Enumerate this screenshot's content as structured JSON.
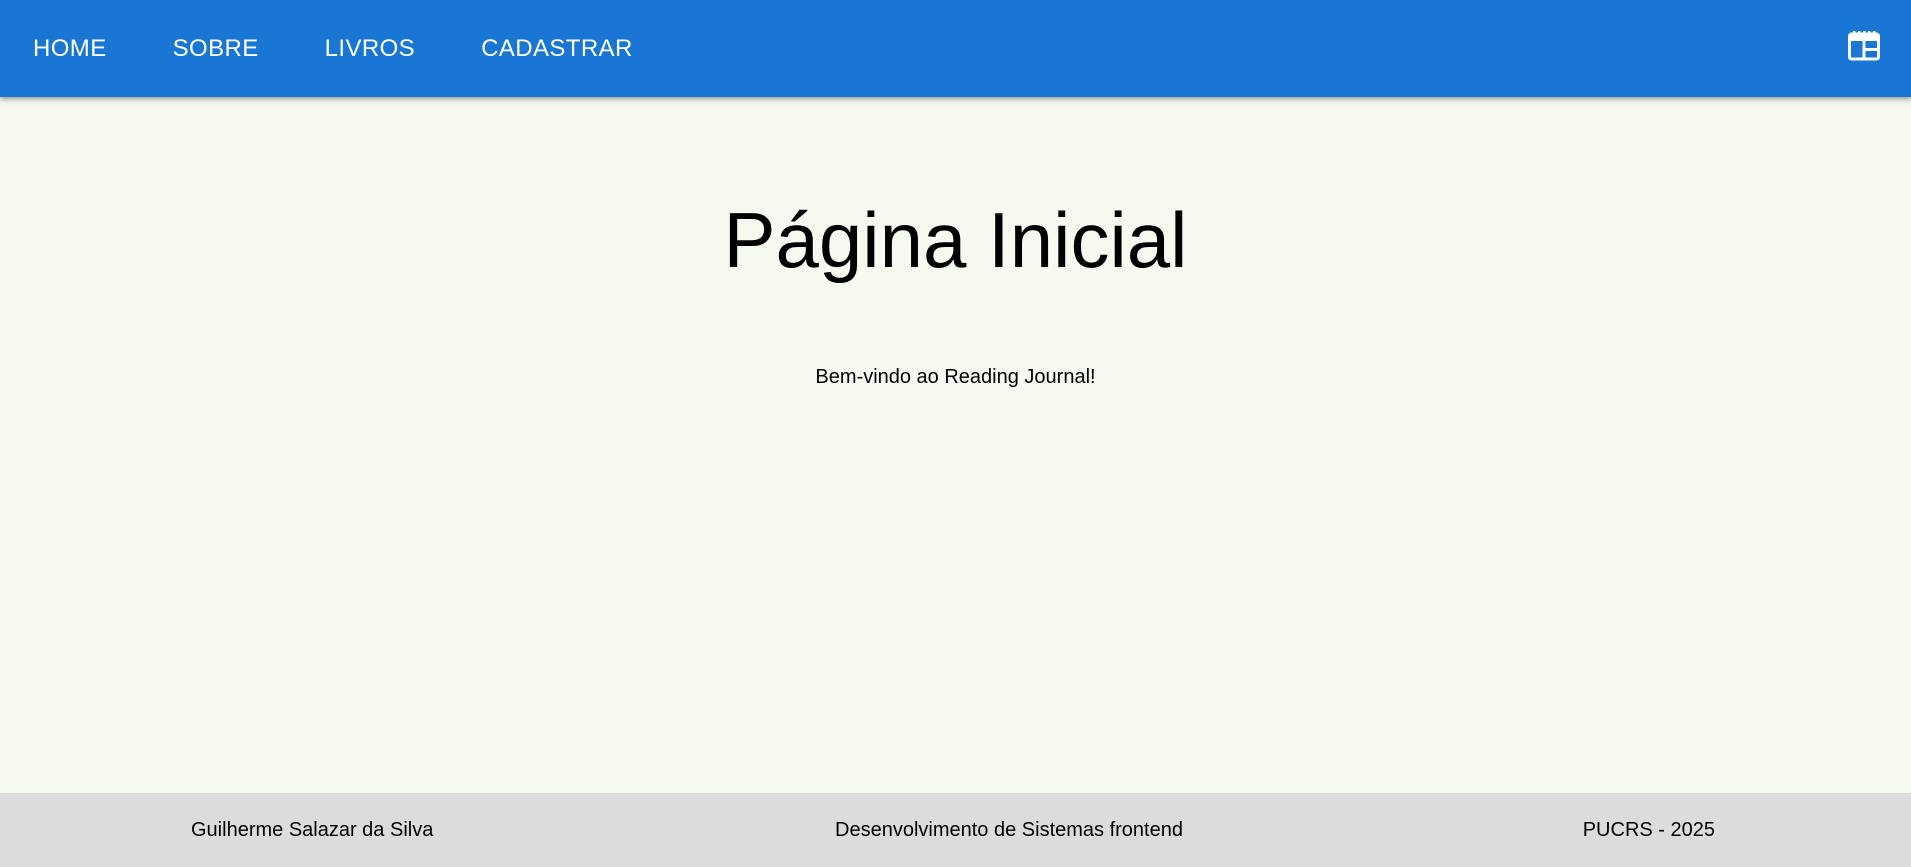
{
  "nav": {
    "items": [
      {
        "label": "HOME"
      },
      {
        "label": "SOBRE"
      },
      {
        "label": "LIVROS"
      },
      {
        "label": "CADASTRAR"
      }
    ],
    "right_icon": "web-layout-icon"
  },
  "main": {
    "title": "Página Inicial",
    "welcome": "Bem-vindo ao Reading Journal!"
  },
  "footer": {
    "author": "Guilherme Salazar da Silva",
    "course": "Desenvolvimento de Sistemas frontend",
    "institution": "PUCRS - 2025"
  },
  "colors": {
    "appbar": "#1976d2",
    "background": "#f6f9ef",
    "footer": "#dcdcdc"
  }
}
